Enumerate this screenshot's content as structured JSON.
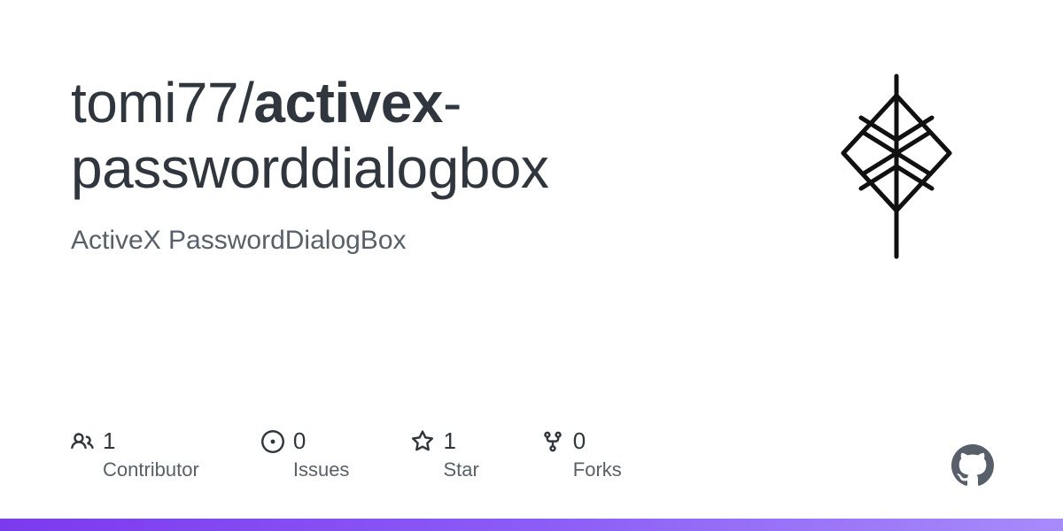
{
  "repo": {
    "owner": "tomi77",
    "separator": "/",
    "name_part1": "activex",
    "hyphen": "-",
    "name_part2": "passworddialogbox",
    "description": "ActiveX PasswordDialogBox"
  },
  "stats": {
    "contributors": {
      "count": "1",
      "label": "Contributor"
    },
    "issues": {
      "count": "0",
      "label": "Issues"
    },
    "stars": {
      "count": "1",
      "label": "Star"
    },
    "forks": {
      "count": "0",
      "label": "Forks"
    }
  },
  "colors": {
    "accent_start": "#7c3aed",
    "accent_end": "#a78bfa"
  }
}
